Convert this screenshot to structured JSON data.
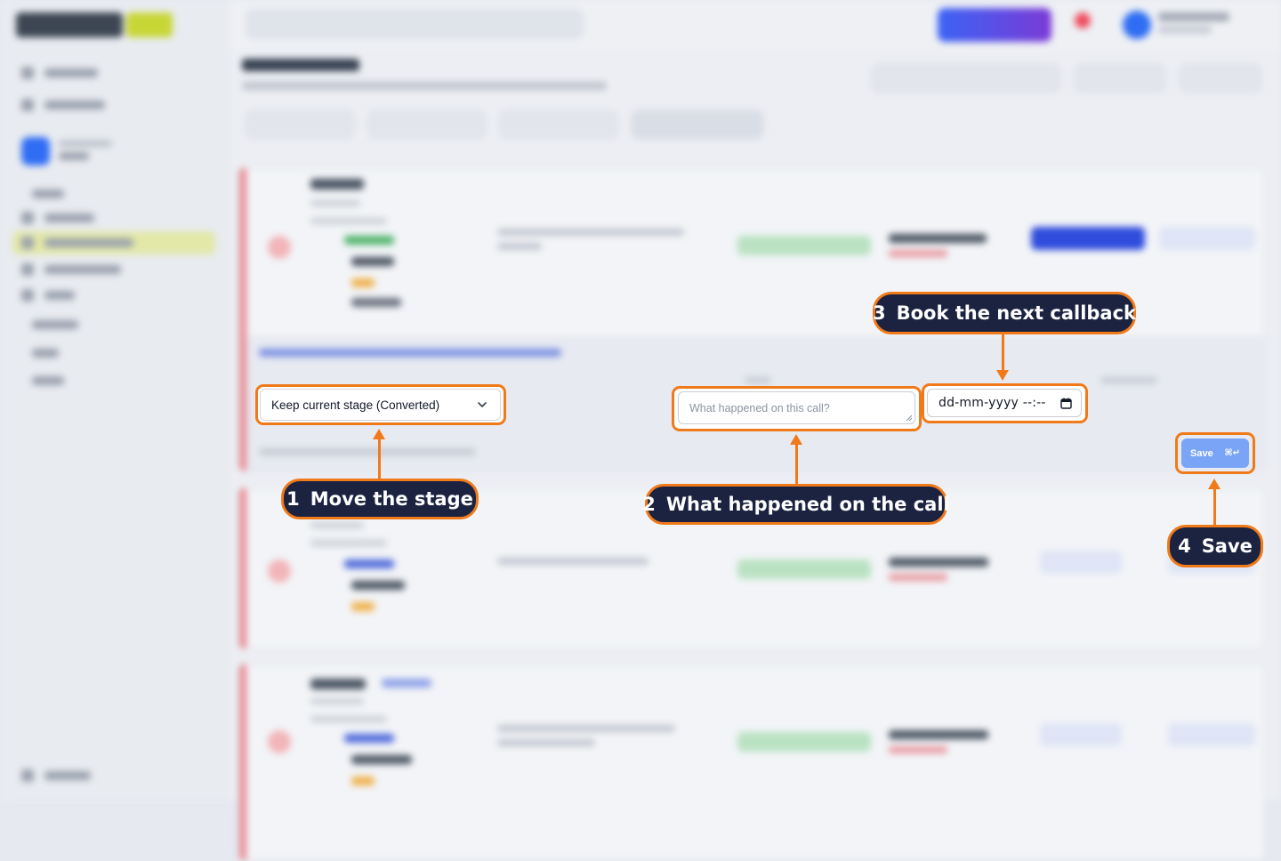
{
  "stage_select": {
    "value": "Keep current stage (Converted)",
    "icon": "chevron-down-icon"
  },
  "notes_field": {
    "placeholder": "What happened on this call?"
  },
  "callback_field": {
    "value": "dd-mm-yyyy --:--",
    "icon": "calendar-icon"
  },
  "save_button": {
    "label": "Save",
    "shortcut": "⌘↵"
  },
  "callouts": [
    {
      "number": "1",
      "label": "Move the stage"
    },
    {
      "number": "2",
      "label": "What happened on the call"
    },
    {
      "number": "3",
      "label": "Book the next callback"
    },
    {
      "number": "4",
      "label": "Save"
    }
  ],
  "colors": {
    "accent": "#f07a1a",
    "callout_bg": "#1b2341",
    "save_button": "#7aa5f7"
  }
}
